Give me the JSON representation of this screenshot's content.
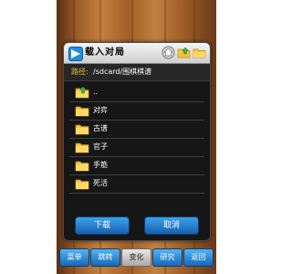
{
  "dialog": {
    "title": "载入对局",
    "path_label": "路径:",
    "path_value": "/sdcard/围棋棋谱",
    "parent_label": "..",
    "folders": [
      "对弈",
      "古谱",
      "官子",
      "手筋",
      "死活"
    ],
    "ok_label": "下载",
    "cancel_label": "取消"
  },
  "tabbar": {
    "items": [
      "菜单",
      "跳转",
      "变化",
      "研究",
      "返回"
    ],
    "active": "变化"
  },
  "icons": {
    "title": "app-logo-icon",
    "home": "home-icon",
    "folder_up": "folder-up-icon",
    "new_folder": "new-folder-icon",
    "folder": "folder-icon",
    "parent_folder": "folder-up-arrow-icon"
  },
  "colors": {
    "path_label": "#e8c23c",
    "button_blue": "#1f78c8",
    "dialog_bg": "#161616",
    "wood": "#b07038"
  }
}
